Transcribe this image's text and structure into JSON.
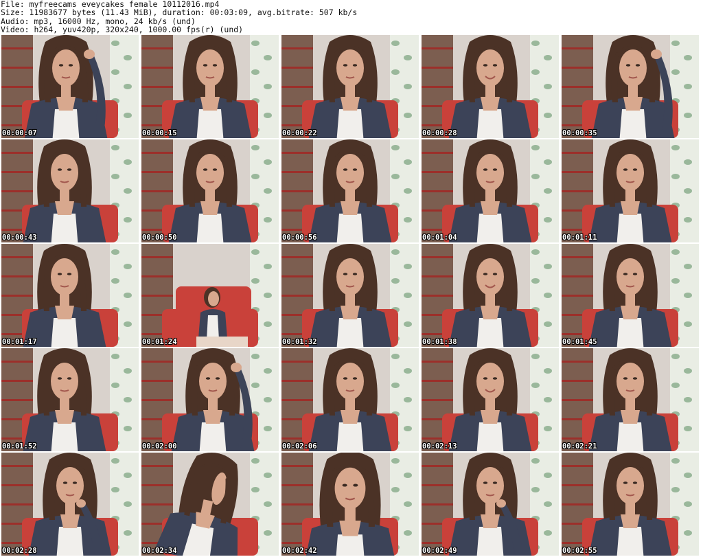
{
  "header": {
    "file": "File: myfreecams_eveycakes_female_10112016.mp4",
    "size": "Size: 11983677 bytes (11.43 MiB), duration: 00:03:09, avg.bitrate: 507 kb/s",
    "audio": "Audio: mp3, 16000 Hz, mono, 24 kb/s (und)",
    "video": "Video: h264, yuv420p, 320x240, 1000.00 fps(r) (und)"
  },
  "thumbnails": [
    {
      "time": "00:00:07",
      "pose": "hand-up-left"
    },
    {
      "time": "00:00:15",
      "pose": "center"
    },
    {
      "time": "00:00:22",
      "pose": "center"
    },
    {
      "time": "00:00:28",
      "pose": "center-smile"
    },
    {
      "time": "00:00:35",
      "pose": "hand-up-right"
    },
    {
      "time": "00:00:43",
      "pose": "center-left"
    },
    {
      "time": "00:00:50",
      "pose": "center"
    },
    {
      "time": "00:00:56",
      "pose": "center"
    },
    {
      "time": "00:01:04",
      "pose": "center"
    },
    {
      "time": "00:01:11",
      "pose": "center"
    },
    {
      "time": "00:01:17",
      "pose": "center-left"
    },
    {
      "time": "00:01:24",
      "pose": "far-away"
    },
    {
      "time": "00:01:32",
      "pose": "center"
    },
    {
      "time": "00:01:38",
      "pose": "center-smile"
    },
    {
      "time": "00:01:45",
      "pose": "center"
    },
    {
      "time": "00:01:52",
      "pose": "center-left"
    },
    {
      "time": "00:02:00",
      "pose": "hand-up-right"
    },
    {
      "time": "00:02:06",
      "pose": "center"
    },
    {
      "time": "00:02:13",
      "pose": "center-smile"
    },
    {
      "time": "00:02:21",
      "pose": "center"
    },
    {
      "time": "00:02:28",
      "pose": "hand-chin"
    },
    {
      "time": "00:02:34",
      "pose": "turned-away"
    },
    {
      "time": "00:02:42",
      "pose": "close-up"
    },
    {
      "time": "00:02:49",
      "pose": "hand-chin"
    },
    {
      "time": "00:02:55",
      "pose": "center"
    }
  ],
  "colors": {
    "wall": "#d9d2cc",
    "curtain": "#e9ede4",
    "curtain_leaf": "#7fa583",
    "chair": "#c9413a",
    "shelf": "#6b4a3a",
    "hair": "#4b3226",
    "skin": "#d8a88e",
    "cardigan": "#3c4358",
    "top": "#f1efec"
  }
}
